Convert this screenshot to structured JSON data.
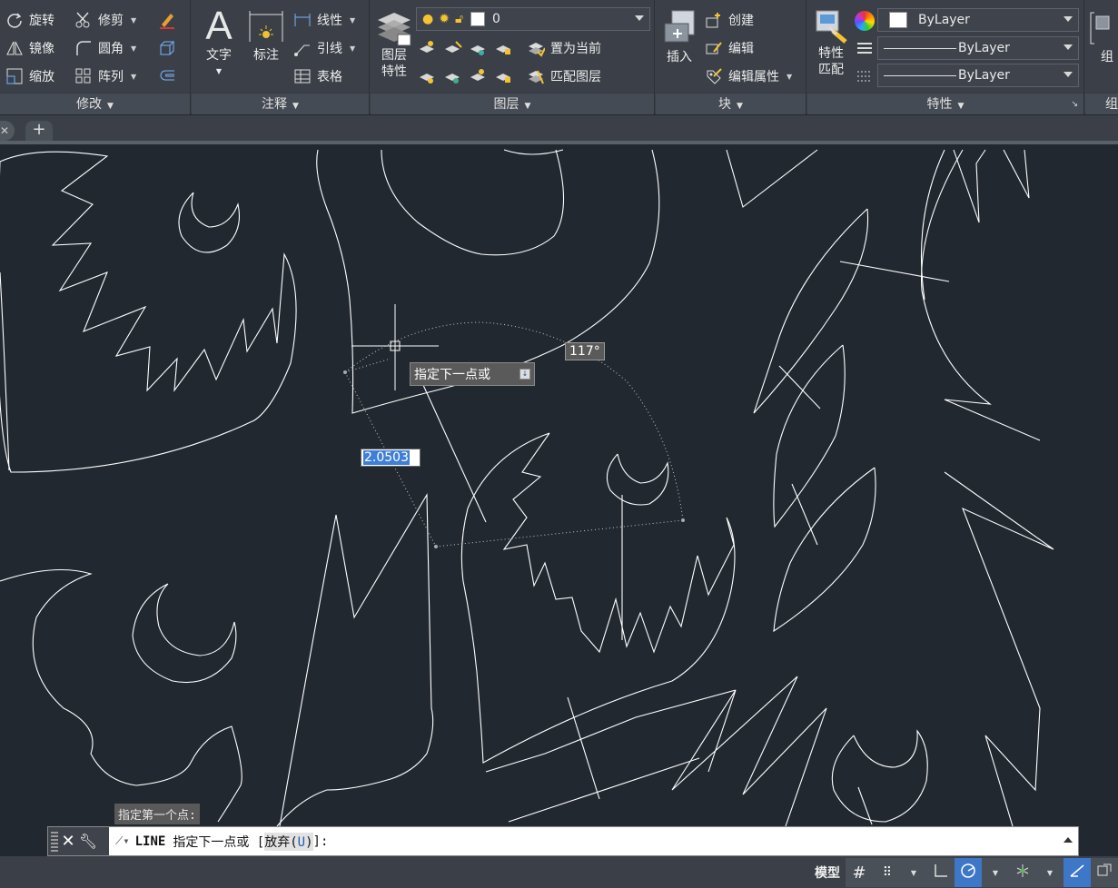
{
  "ribbon": {
    "modify": {
      "title": "修改",
      "rotate": "旋转",
      "trim": "修剪",
      "mirror": "镜像",
      "fillet": "圆角",
      "scale": "缩放",
      "array": "阵列"
    },
    "annotation": {
      "title": "注释",
      "text": "文字",
      "dimension": "标注",
      "linear": "线性",
      "leader": "引线",
      "table": "表格"
    },
    "layers": {
      "title": "图层",
      "layer_properties_line1": "图层",
      "layer_properties_line2": "特性",
      "current_layer": "0",
      "make_current": "置为当前",
      "match_layer": "匹配图层"
    },
    "block": {
      "title": "块",
      "insert": "插入",
      "create": "创建",
      "edit": "编辑",
      "edit_attributes": "编辑属性"
    },
    "properties": {
      "title": "特性",
      "match_line1": "特性",
      "match_line2": "匹配",
      "color": "ByLayer",
      "linetype": "ByLayer",
      "lineweight": "ByLayer"
    },
    "group": {
      "label": "组",
      "title": "组"
    }
  },
  "canvas": {
    "tooltip": "指定下一点或",
    "angle": "117°",
    "length_input": "2.0503",
    "history_prompt": "指定第一个点:"
  },
  "command": {
    "name": "LINE",
    "prompt": "指定下一点或 [",
    "option_text": "放弃(",
    "option_key": "U",
    "option_close": ")",
    "suffix": "]:"
  },
  "status": {
    "model": "模型"
  },
  "colors": {
    "background": "#212830",
    "ribbon": "#3b4048",
    "accent": "#3e77c8"
  }
}
